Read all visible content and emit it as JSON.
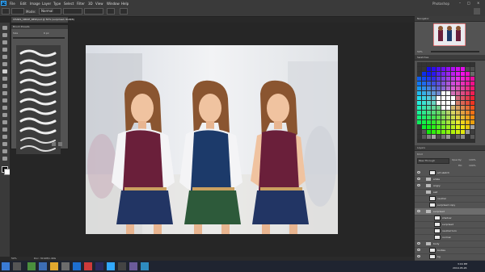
{
  "app": {
    "name": "Ps",
    "window_title": "Photoshop"
  },
  "menu": [
    "File",
    "Edit",
    "Image",
    "Layer",
    "Type",
    "Select",
    "Filter",
    "3D",
    "View",
    "Window",
    "Help"
  ],
  "options_bar": {
    "mode_label": "Normal"
  },
  "document": {
    "tab_title": "CHARS_SMIKE_NEW.psd @ 50% (surprised, RGB/8)",
    "zoom": "50%",
    "doc_info": "Doc: 30.9M/1.49G"
  },
  "brush_panel": {
    "title": "Brush Presets",
    "size_label": "Size",
    "size_value": "6 px"
  },
  "navigator": {
    "title": "Navigator",
    "zoom": "50%"
  },
  "swatches": {
    "title": "Swatches"
  },
  "layers": {
    "title": "Layers",
    "kind_label": "Kind",
    "blend": "Pass Through",
    "opacity_label": "Opacity:",
    "opacity": "100%",
    "fill_label": "Fill:",
    "fill": "100%",
    "items": [
      {
        "name": "art sketch"
      },
      {
        "name": "smile"
      },
      {
        "name": "angry"
      },
      {
        "name": "sad"
      },
      {
        "name": "neutral"
      },
      {
        "name": "surprised copy"
      },
      {
        "name": "surprised"
      },
      {
        "name": "shadow"
      },
      {
        "name": "surprised"
      },
      {
        "name": "neutral turn"
      },
      {
        "name": "normal"
      },
      {
        "name": "body"
      },
      {
        "name": "bodies"
      },
      {
        "name": "bg"
      }
    ]
  },
  "taskbar": {
    "time": "3:04 PM",
    "date": "2019-05-26"
  },
  "colors": {
    "ui_dark": "#282828",
    "panel": "#535353",
    "accent": "#31a8ff",
    "vest_maroon": "#6a1f3a",
    "vest_navy": "#1c3a6a",
    "skirt_green": "#2d5a3a"
  }
}
